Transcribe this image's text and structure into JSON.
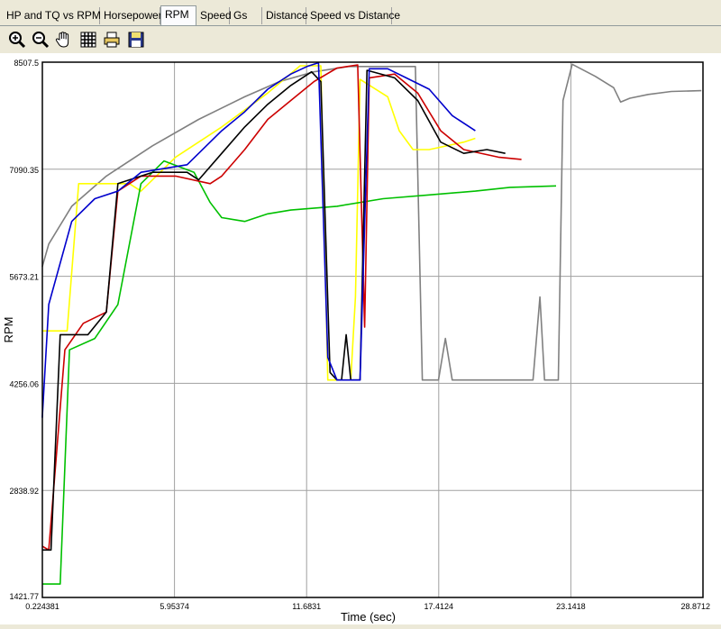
{
  "tabs": [
    {
      "label": "HP and TQ vs RPM",
      "active": false
    },
    {
      "label": "Horsepower",
      "active": false
    },
    {
      "label": "RPM",
      "active": true
    },
    {
      "label": "Speed",
      "active": false
    },
    {
      "label": "Gs",
      "active": false
    },
    {
      "label": "Distance",
      "active": false
    },
    {
      "label": "Speed vs Distance",
      "active": false
    }
  ],
  "toolbar": {
    "icons": [
      "zoom-in-icon",
      "zoom-out-icon",
      "pan-hand-icon",
      "grid-icon",
      "print-icon",
      "save-icon"
    ]
  },
  "chart_data": {
    "type": "line",
    "xlabel": "Time (sec)",
    "ylabel": "RPM",
    "xlim": [
      0.224381,
      28.8712
    ],
    "ylim": [
      1421.77,
      8507.5
    ],
    "x_ticks": [
      "0.224381",
      "5.95374",
      "11.6831",
      "17.4124",
      "23.1418",
      "28.8712"
    ],
    "y_ticks": [
      "1421.77",
      "2838.92",
      "4256.06",
      "5673.21",
      "7090.35",
      "8507.5"
    ],
    "grid": true,
    "series": [
      {
        "color": "#808080",
        "points": [
          [
            0.22,
            5800
          ],
          [
            0.5,
            6100
          ],
          [
            1.5,
            6600
          ],
          [
            3,
            7000
          ],
          [
            5,
            7400
          ],
          [
            7,
            7750
          ],
          [
            9,
            8050
          ],
          [
            10.5,
            8250
          ],
          [
            12,
            8380
          ],
          [
            13.5,
            8450
          ],
          [
            15.4,
            8450
          ],
          [
            16.4,
            8450
          ],
          [
            16.7,
            4300
          ],
          [
            17.4,
            4300
          ],
          [
            17.7,
            4850
          ],
          [
            18.0,
            4300
          ],
          [
            21.5,
            4300
          ],
          [
            21.8,
            5400
          ],
          [
            22.0,
            4300
          ],
          [
            22.6,
            4300
          ],
          [
            22.8,
            8000
          ],
          [
            23.2,
            8480
          ],
          [
            24.2,
            8320
          ],
          [
            25,
            8170
          ],
          [
            25.3,
            7980
          ],
          [
            25.7,
            8030
          ],
          [
            26.5,
            8080
          ],
          [
            27.5,
            8120
          ],
          [
            28.8,
            8130
          ]
        ]
      },
      {
        "color": "#ffff00",
        "points": [
          [
            0.22,
            4950
          ],
          [
            1.3,
            4950
          ],
          [
            1.8,
            6900
          ],
          [
            4,
            6900
          ],
          [
            4.5,
            6800
          ],
          [
            5,
            6950
          ],
          [
            6,
            7250
          ],
          [
            8,
            7650
          ],
          [
            10,
            8100
          ],
          [
            11.4,
            8460
          ],
          [
            12.3,
            8460
          ],
          [
            12.6,
            4300
          ],
          [
            13.6,
            4300
          ],
          [
            13.8,
            5400
          ],
          [
            14.0,
            8280
          ],
          [
            15.2,
            8050
          ],
          [
            15.7,
            7600
          ],
          [
            16.3,
            7350
          ],
          [
            17.0,
            7350
          ],
          [
            18.5,
            7450
          ],
          [
            19,
            7500
          ]
        ]
      },
      {
        "color": "#00c000",
        "points": [
          [
            0.22,
            1600
          ],
          [
            1.0,
            1600
          ],
          [
            1.4,
            4700
          ],
          [
            2.5,
            4850
          ],
          [
            3.5,
            5300
          ],
          [
            4.5,
            6900
          ],
          [
            5.5,
            7200
          ],
          [
            6.8,
            7050
          ],
          [
            7.5,
            6650
          ],
          [
            8.0,
            6450
          ],
          [
            9,
            6400
          ],
          [
            10,
            6500
          ],
          [
            11,
            6550
          ],
          [
            13,
            6600
          ],
          [
            15,
            6700
          ],
          [
            17,
            6750
          ],
          [
            19,
            6800
          ],
          [
            20.5,
            6850
          ],
          [
            22.5,
            6870
          ]
        ]
      },
      {
        "color": "#cc0000",
        "points": [
          [
            0.22,
            2100
          ],
          [
            0.5,
            2050
          ],
          [
            1.2,
            4700
          ],
          [
            2,
            5050
          ],
          [
            3,
            5200
          ],
          [
            3.5,
            6800
          ],
          [
            4.5,
            7000
          ],
          [
            6,
            7000
          ],
          [
            7.5,
            6900
          ],
          [
            8,
            7000
          ],
          [
            9,
            7350
          ],
          [
            10,
            7750
          ],
          [
            11,
            8000
          ],
          [
            12,
            8250
          ],
          [
            13,
            8430
          ],
          [
            13.9,
            8470
          ],
          [
            14.2,
            5000
          ],
          [
            14.4,
            8300
          ],
          [
            15.5,
            8350
          ],
          [
            16.5,
            8100
          ],
          [
            17.5,
            7600
          ],
          [
            18.5,
            7350
          ],
          [
            20,
            7250
          ],
          [
            21,
            7220
          ]
        ]
      },
      {
        "color": "#000000",
        "points": [
          [
            0.22,
            2050
          ],
          [
            0.6,
            2050
          ],
          [
            1.0,
            4900
          ],
          [
            2.2,
            4900
          ],
          [
            3,
            5200
          ],
          [
            3.5,
            6900
          ],
          [
            5,
            7050
          ],
          [
            6.5,
            7050
          ],
          [
            7,
            6950
          ],
          [
            8,
            7300
          ],
          [
            9,
            7650
          ],
          [
            10,
            7950
          ],
          [
            11,
            8200
          ],
          [
            11.9,
            8380
          ],
          [
            12.3,
            8250
          ],
          [
            12.7,
            4400
          ],
          [
            13.0,
            4300
          ],
          [
            13.2,
            4300
          ],
          [
            13.4,
            4900
          ],
          [
            13.6,
            4300
          ],
          [
            14.0,
            4300
          ],
          [
            14.3,
            8400
          ],
          [
            15.5,
            8300
          ],
          [
            16.5,
            8000
          ],
          [
            17.5,
            7450
          ],
          [
            18.5,
            7300
          ],
          [
            19.5,
            7350
          ],
          [
            20.3,
            7300
          ]
        ]
      },
      {
        "color": "#0000cc",
        "points": [
          [
            0.22,
            3800
          ],
          [
            0.5,
            5300
          ],
          [
            1.5,
            6400
          ],
          [
            2.5,
            6700
          ],
          [
            3.5,
            6800
          ],
          [
            4.5,
            7050
          ],
          [
            6.5,
            7150
          ],
          [
            8,
            7600
          ],
          [
            9,
            7850
          ],
          [
            10,
            8150
          ],
          [
            11,
            8350
          ],
          [
            11.7,
            8450
          ],
          [
            12.2,
            8500
          ],
          [
            12.6,
            4600
          ],
          [
            13.0,
            4300
          ],
          [
            13.4,
            4300
          ],
          [
            14.0,
            4300
          ],
          [
            14.4,
            8420
          ],
          [
            15.2,
            8420
          ],
          [
            16.0,
            8300
          ],
          [
            17,
            8150
          ],
          [
            18,
            7800
          ],
          [
            19,
            7600
          ]
        ]
      }
    ]
  }
}
